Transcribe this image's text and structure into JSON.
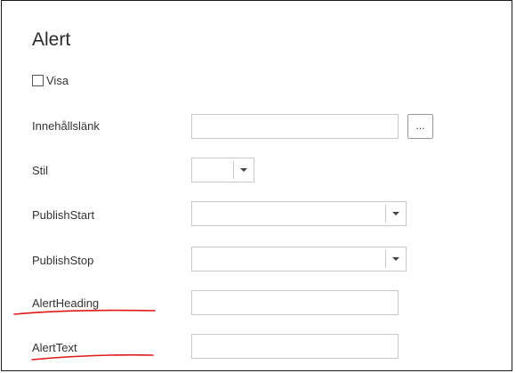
{
  "form": {
    "title": "Alert",
    "visa_label": "Visa",
    "visa_checked": false,
    "fields": {
      "content_link": {
        "label": "Innehållslänk",
        "value": "",
        "button_label": "..."
      },
      "style": {
        "label": "Stil",
        "value": ""
      },
      "publish_start": {
        "label": "PublishStart",
        "value": ""
      },
      "publish_stop": {
        "label": "PublishStop",
        "value": ""
      },
      "alert_heading": {
        "label": "AlertHeading",
        "value": ""
      },
      "alert_text": {
        "label": "AlertText",
        "value": ""
      }
    }
  },
  "annotation_color": "#e01818"
}
